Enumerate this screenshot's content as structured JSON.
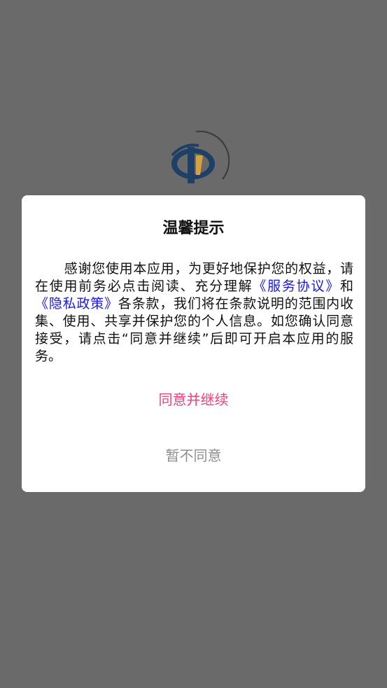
{
  "dialog": {
    "title": "温馨提示",
    "body_part1": "感谢您使用本应用，为更好地保护您的权益，请在使用前务必点击阅读、充分理解",
    "service_link": "《服务协议》",
    "body_part2": "和",
    "privacy_link": "《隐私政策》",
    "body_part3": "各条款，我们将在条款说明的范围内收集、使用、共享并保护您的个人信息。如您确认同意接受，请点击“同意并继续”后即可开启本应用的服务。",
    "agree_label": "同意并继续",
    "disagree_label": "暂不同意"
  },
  "colors": {
    "overlay": "#6a6a6a",
    "link": "#1a1ad6",
    "agree": "#e8437a",
    "disagree": "#8e8e93"
  },
  "icons": {
    "splash_logo": "app-logo-icon"
  }
}
